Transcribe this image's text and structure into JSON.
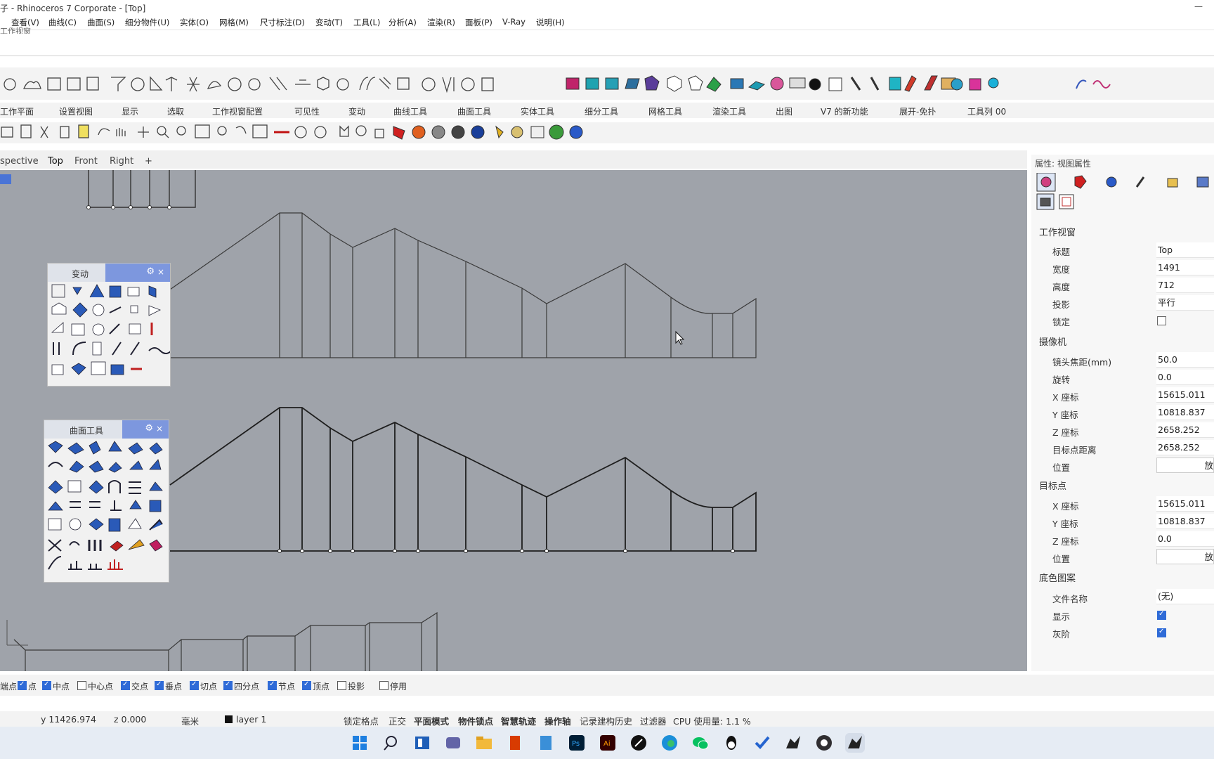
{
  "window": {
    "title": "子 - Rhinoceros 7 Corporate - [Top]"
  },
  "menu": [
    "查看(V)",
    "曲线(C)",
    "曲面(S)",
    "细分物件(U)",
    "实体(O)",
    "网格(M)",
    "尺寸标注(D)",
    "变动(T)",
    "工具(L)",
    "分析(A)",
    "渲染(R)",
    "面板(P)",
    "V-Ray",
    "说明(H)"
  ],
  "command": {
    "prompt": "工作视窗"
  },
  "toolbar_tabs": [
    "工作平面",
    "设置视图",
    "显示",
    "选取",
    "工作视窗配置",
    "可见性",
    "变动",
    "曲线工具",
    "曲面工具",
    "实体工具",
    "细分工具",
    "网格工具",
    "渲染工具",
    "出图",
    "V7 的新功能",
    "展开-免扑",
    "工具列 00"
  ],
  "viewport_tabs": {
    "tabs": [
      "spective",
      "Top",
      "Front",
      "Right"
    ],
    "active": "Top",
    "add": "+"
  },
  "panels": {
    "transform": {
      "title": "变动"
    },
    "surface_tools": {
      "title": "曲面工具"
    }
  },
  "properties": {
    "header": "属性: 视图属性",
    "sections": {
      "viewport": "工作视窗",
      "camera": "摄像机",
      "target": "目标点",
      "wallpaper": "底色图案"
    },
    "viewport": {
      "title_label": "标题",
      "title_value": "Top",
      "width_label": "宽度",
      "width_value": "1491",
      "height_label": "高度",
      "height_value": "712",
      "projection_label": "投影",
      "projection_value": "平行",
      "lock_label": "锁定",
      "lock_checked": false
    },
    "camera": {
      "lens_label": "镜头焦距(mm)",
      "lens_value": "50.0",
      "rotation_label": "旋转",
      "rotation_value": "0.0",
      "x_label": "X 座标",
      "x_value": "15615.011",
      "y_label": "Y 座标",
      "y_value": "10818.837",
      "z_label": "Z 座标",
      "z_value": "2658.252",
      "dist_label": "目标点距离",
      "dist_value": "2658.252",
      "pos_label": "位置",
      "pos_button": "放"
    },
    "target": {
      "x_label": "X 座标",
      "x_value": "15615.011",
      "y_label": "Y 座标",
      "y_value": "10818.837",
      "z_label": "Z 座标",
      "z_value": "0.0",
      "pos_label": "位置",
      "pos_button": "放"
    },
    "wallpaper": {
      "file_label": "文件名称",
      "file_value": "(无)",
      "show_label": "显示",
      "show_checked": true,
      "gray_label": "灰阶",
      "gray_checked": true
    }
  },
  "osnaps": [
    {
      "label": "端点",
      "checked": true
    },
    {
      "label": "点",
      "checked": true
    },
    {
      "label": "中点",
      "checked": true
    },
    {
      "label": "中心点",
      "checked": false
    },
    {
      "label": "交点",
      "checked": true
    },
    {
      "label": "垂点",
      "checked": true
    },
    {
      "label": "切点",
      "checked": true
    },
    {
      "label": "四分点",
      "checked": true
    },
    {
      "label": "节点",
      "checked": true
    },
    {
      "label": "顶点",
      "checked": true
    },
    {
      "label": "投影",
      "checked": false
    },
    {
      "label": "停用",
      "checked": false
    }
  ],
  "status": {
    "y": "y 11426.974",
    "z": "z 0.000",
    "units": "毫米",
    "layer": "layer 1",
    "grid_snap": "锁定格点",
    "ortho": "正交",
    "planar": "平面模式",
    "osnap": "物件锁点",
    "smart_track": "智慧轨迹",
    "gumball": "操作轴",
    "history": "记录建构历史",
    "filter": "过滤器",
    "cpu": "CPU 使用量: 1.1 %"
  },
  "taskbar_apps": [
    "start-icon",
    "search-icon",
    "widgets-icon",
    "chat-icon",
    "explorer-icon",
    "office-icon",
    "notepad-icon",
    "photoshop-icon",
    "illustrator-icon",
    "pen-icon",
    "edge-icon",
    "wechat-icon",
    "qq-icon",
    "todo-icon",
    "rhino-icon",
    "obs-icon",
    "rhino7-icon"
  ],
  "colors": {
    "viewport_bg": "#9fa3aa",
    "accent": "#2f6bd7",
    "panel_header": "#7d97de"
  }
}
